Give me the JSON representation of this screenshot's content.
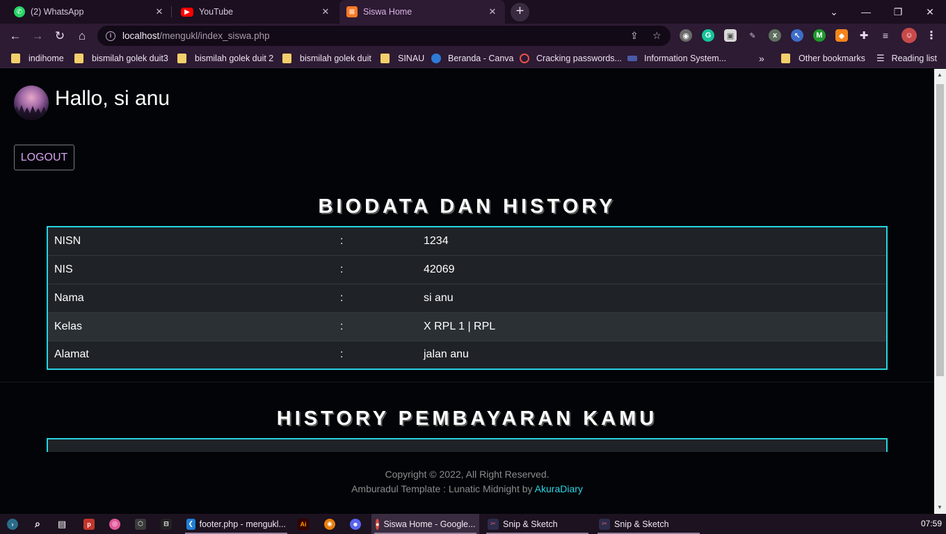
{
  "browser": {
    "tabs": [
      {
        "label": "(2) WhatsApp",
        "icon": "whatsapp-icon",
        "color": "#25d366"
      },
      {
        "label": "YouTube",
        "icon": "youtube-icon",
        "color": "#ff0000"
      },
      {
        "label": "Siswa Home",
        "icon": "xampp-icon",
        "color": "#fb7a24"
      }
    ],
    "url_host": "localhost",
    "url_path": "/mengukl/index_siswa.php",
    "bookmarks": [
      {
        "label": "indihome",
        "type": "folder"
      },
      {
        "label": "bismilah golek duit3",
        "type": "folder"
      },
      {
        "label": "bismilah golek duit 2",
        "type": "folder"
      },
      {
        "label": "bismilah golek duit",
        "type": "folder"
      },
      {
        "label": "SINAU",
        "type": "folder"
      },
      {
        "label": "Beranda - Canva",
        "type": "site"
      },
      {
        "label": "Cracking passwords...",
        "type": "site"
      },
      {
        "label": "Information System...",
        "type": "site"
      },
      {
        "label": "»",
        "type": "overflow"
      },
      {
        "label": "Other bookmarks",
        "type": "folder"
      },
      {
        "label": "Reading list",
        "type": "reading-list"
      }
    ]
  },
  "page": {
    "greeting": "Hallo, si anu",
    "logout_label": "LOGOUT",
    "biodata_heading": "BIODATA DAN HISTORY",
    "biodata": [
      {
        "label": "NISN",
        "sep": ":",
        "value": "1234"
      },
      {
        "label": "NIS",
        "sep": ":",
        "value": "42069"
      },
      {
        "label": "Nama",
        "sep": ":",
        "value": "si anu"
      },
      {
        "label": "Kelas",
        "sep": ":",
        "value": "X RPL 1 | RPL"
      },
      {
        "label": "Alamat",
        "sep": ":",
        "value": "jalan anu"
      }
    ],
    "history_heading": "HISTORY PEMBAYARAN KAMU",
    "footer_line1": "Copyright © 2022, All Right Reserved.",
    "footer_line2_prefix": "Amburadul Template : Lunatic Midnight by ",
    "footer_link": "AkuraDiary"
  },
  "taskbar": {
    "items": [
      {
        "label": "footer.php - mengukl...",
        "icon": "vscode-icon"
      },
      {
        "label": "Siswa Home - Google...",
        "icon": "chrome-icon"
      },
      {
        "label": "Snip & Sketch",
        "icon": "snip-sketch-icon"
      },
      {
        "label": "Snip & Sketch",
        "icon": "snip-sketch-icon"
      }
    ],
    "clock": "07:59"
  },
  "colors": {
    "accent": "#27d4e0",
    "logout_text": "#d6a3f0",
    "page_bg": "#020407",
    "browser_chrome": "#2d1a33"
  }
}
